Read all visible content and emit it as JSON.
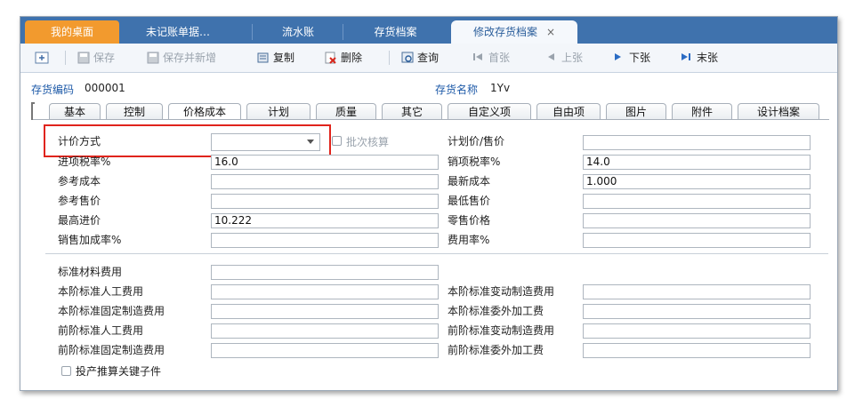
{
  "tabs": [
    {
      "label": "我的桌面"
    },
    {
      "label": "未记账单据…"
    },
    {
      "label": "流水账"
    },
    {
      "label": "存货档案"
    },
    {
      "label": "修改存货档案",
      "close": "×"
    }
  ],
  "toolbar": {
    "save": "保存",
    "save_new": "保存并新增",
    "copy": "复制",
    "delete": "删除",
    "query": "查询",
    "first": "首张",
    "prev": "上张",
    "next": "下张",
    "last": "末张"
  },
  "header": {
    "code_label": "存货编码",
    "code_value": "000001",
    "name_label": "存货名称",
    "name_value": "1Yv"
  },
  "subtabs": [
    "基本",
    "控制",
    "价格成本",
    "计划",
    "质量",
    "其它",
    "自定义项",
    "自由项",
    "图片",
    "附件",
    "设计档案"
  ],
  "form": {
    "pricing_method": {
      "label": "计价方式",
      "value": ""
    },
    "batch_check": {
      "label": "批次核算",
      "checked": false
    },
    "plan_price": {
      "label": "计划价/售价",
      "value": ""
    },
    "input_tax": {
      "label": "进项税率%",
      "value": "16.0"
    },
    "sales_tax": {
      "label": "销项税率%",
      "value": "14.0"
    },
    "ref_cost": {
      "label": "参考成本",
      "value": ""
    },
    "latest_cost": {
      "label": "最新成本",
      "value": "1.000"
    },
    "ref_price": {
      "label": "参考售价",
      "value": ""
    },
    "min_price": {
      "label": "最低售价",
      "value": ""
    },
    "max_purchase": {
      "label": "最高进价",
      "value": "10.222"
    },
    "retail_price": {
      "label": "零售价格",
      "value": ""
    },
    "sales_markup": {
      "label": "销售加成率%",
      "value": ""
    },
    "expense_rate": {
      "label": "费用率%",
      "value": ""
    },
    "std_material": {
      "label": "标准材料费用",
      "value": ""
    },
    "cur_labor": {
      "label": "本阶标准人工费用",
      "value": ""
    },
    "cur_var_mfg": {
      "label": "本阶标准变动制造费用",
      "value": ""
    },
    "cur_fixed_mfg": {
      "label": "本阶标准固定制造费用",
      "value": ""
    },
    "cur_outsource": {
      "label": "本阶标准委外加工费",
      "value": ""
    },
    "prev_labor": {
      "label": "前阶标准人工费用",
      "value": ""
    },
    "prev_var_mfg": {
      "label": "前阶标准变动制造费用",
      "value": ""
    },
    "prev_fixed_mfg": {
      "label": "前阶标准固定制造费用",
      "value": ""
    },
    "prev_outsource": {
      "label": "前阶标准委外加工费",
      "value": ""
    },
    "key_part": {
      "label": "投产推算关键子件",
      "checked": false
    }
  },
  "colors": {
    "tabbar": "#3f72ad",
    "active_tab": "#f29a2e",
    "highlight": "#e0241c",
    "label_blue": "#1e5aa8"
  }
}
